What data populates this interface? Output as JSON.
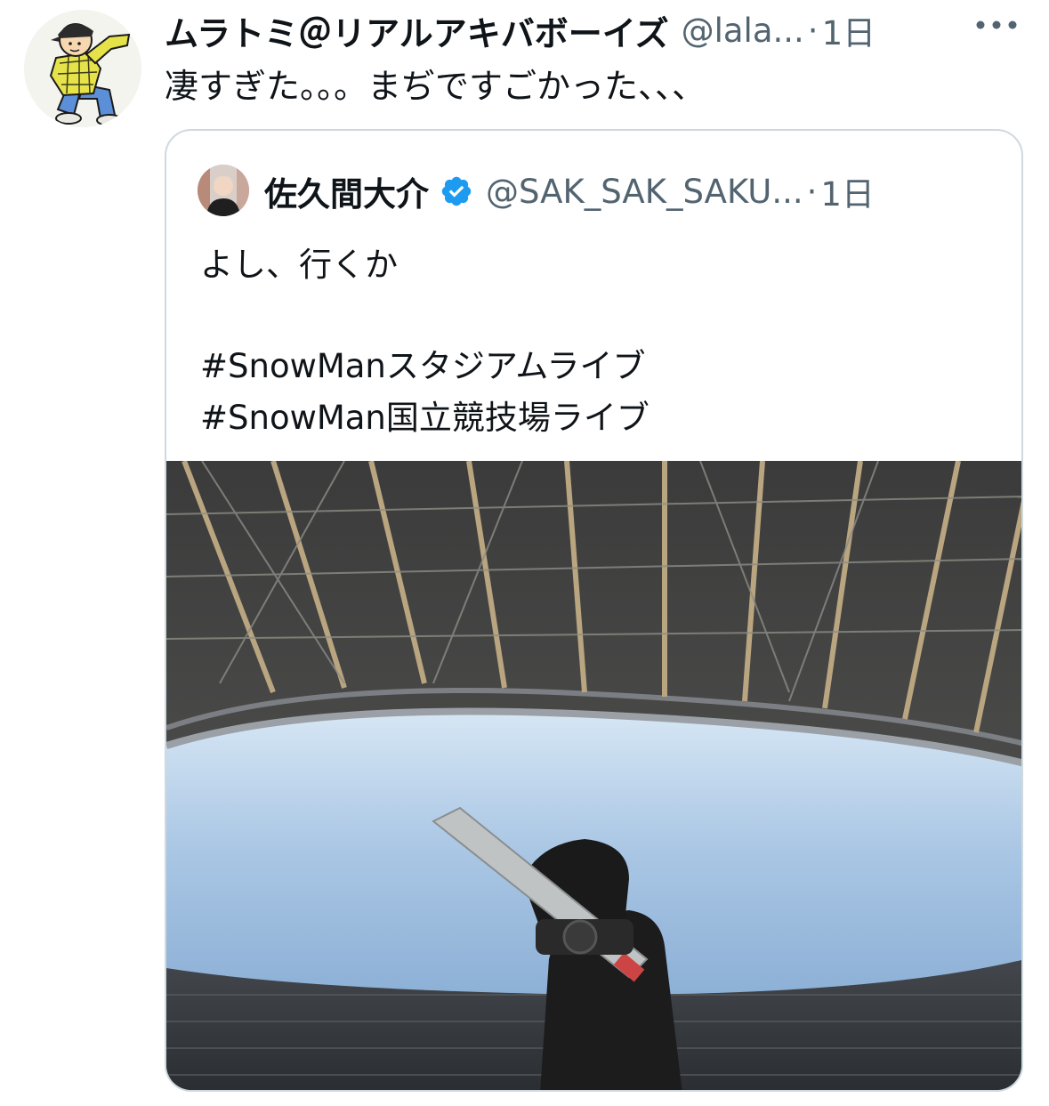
{
  "tweet": {
    "display_name": "ムラトミ＠リアルアキバボーイズ",
    "handle": "@lala...",
    "separator": "·",
    "time": "1日",
    "more_label": "···",
    "text": "凄すぎた。。。まぢですごかった、、、"
  },
  "quote": {
    "display_name": "佐久間大介",
    "handle": "@SAK_SAK_SAKU...",
    "separator": "·",
    "time": "1日",
    "line1": "よし、行くか",
    "hashtag1": "#SnowManスタジアムライブ",
    "hashtag2": "#SnowMan国立競技場ライブ"
  },
  "colors": {
    "text_primary": "#0f1419",
    "text_secondary": "#536471",
    "border": "#cfd9de",
    "verified": "#1d9bf0"
  },
  "icons": {
    "more": "more-horizontal-icon",
    "verified": "verified-badge-icon"
  }
}
